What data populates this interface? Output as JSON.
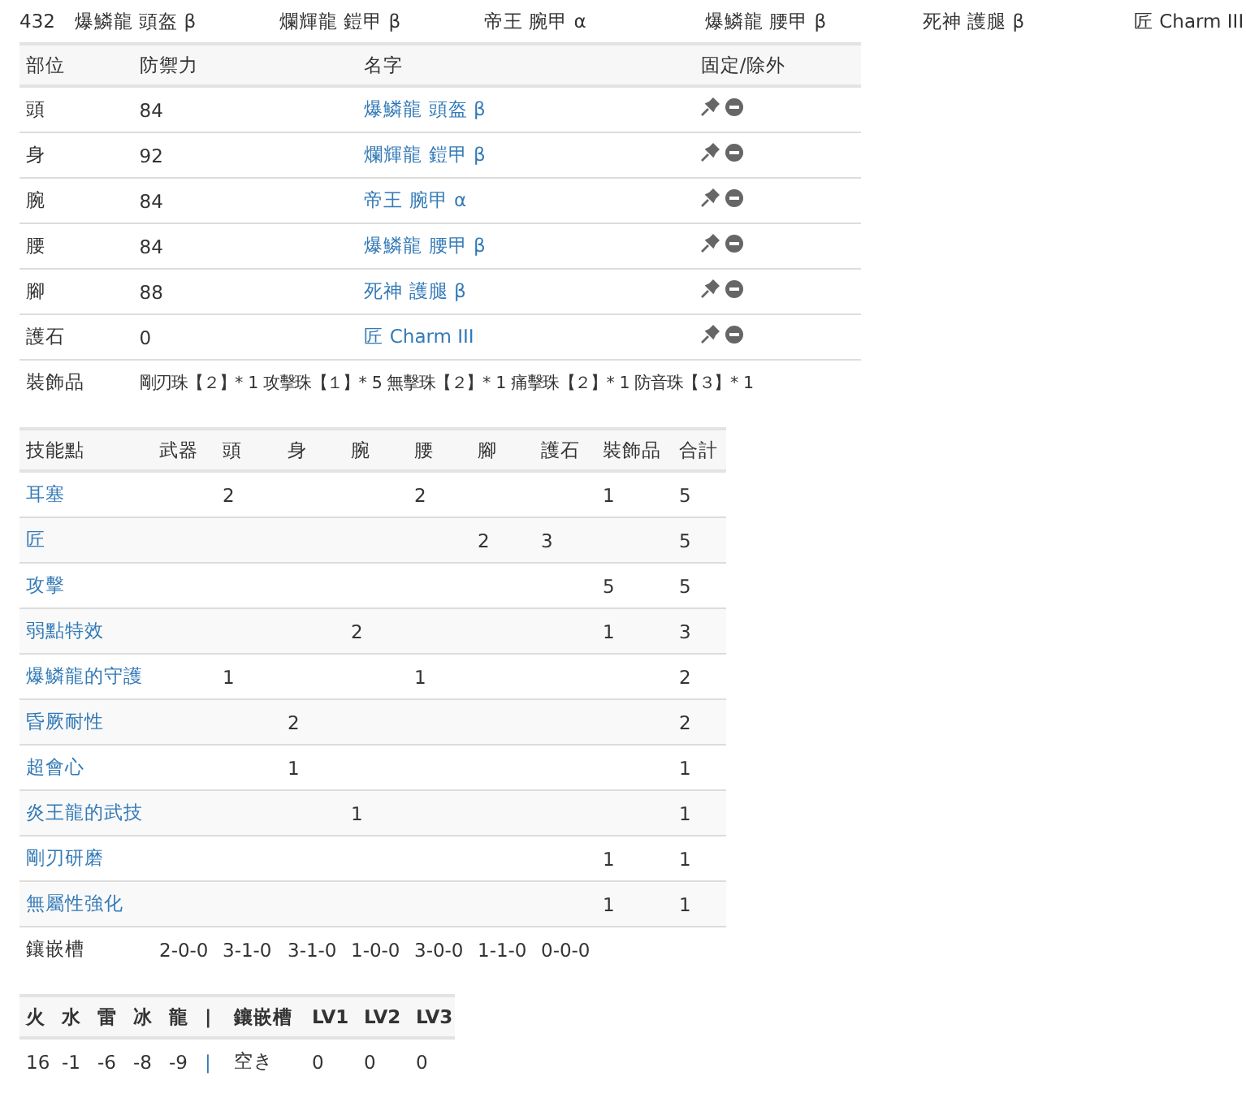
{
  "summary": {
    "defense": "432",
    "pieces": [
      "爆鱗龍 頭盔 β",
      "爛輝龍 鎧甲 β",
      "帝王 腕甲 α",
      "爆鱗龍 腰甲 β",
      "死神 護腿 β",
      "匠 Charm III"
    ]
  },
  "armor_table": {
    "columns": [
      "部位",
      "防禦力",
      "名字",
      "固定/除外"
    ],
    "rows": [
      {
        "part": "頭",
        "defense": "84",
        "name": "爆鱗龍 頭盔 β"
      },
      {
        "part": "身",
        "defense": "92",
        "name": "爛輝龍 鎧甲 β"
      },
      {
        "part": "腕",
        "defense": "84",
        "name": "帝王 腕甲 α"
      },
      {
        "part": "腰",
        "defense": "84",
        "name": "爆鱗龍 腰甲 β"
      },
      {
        "part": "腳",
        "defense": "88",
        "name": "死神 護腿 β"
      },
      {
        "part": "護石",
        "defense": "0",
        "name": "匠 Charm III"
      }
    ],
    "decorations": {
      "label": "裝飾品",
      "text": "剛刃珠【２】* 1 攻擊珠【１】* 5 無擊珠【２】* 1 痛擊珠【２】* 1 防音珠【３】* 1"
    }
  },
  "skill_table": {
    "columns": [
      "技能點",
      "武器",
      "頭",
      "身",
      "腕",
      "腰",
      "腳",
      "護石",
      "裝飾品",
      "合計"
    ],
    "rows": [
      {
        "cells": [
          "耳塞",
          "",
          "2",
          "",
          "",
          "2",
          "",
          "",
          "1",
          "5"
        ]
      },
      {
        "cells": [
          "匠",
          "",
          "",
          "",
          "",
          "",
          "2",
          "3",
          "",
          "5"
        ]
      },
      {
        "cells": [
          "攻擊",
          "",
          "",
          "",
          "",
          "",
          "",
          "",
          "5",
          "5"
        ]
      },
      {
        "cells": [
          "弱點特效",
          "",
          "",
          "",
          "2",
          "",
          "",
          "",
          "1",
          "3"
        ]
      },
      {
        "cells": [
          "爆鱗龍的守護",
          "",
          "1",
          "",
          "",
          "1",
          "",
          "",
          "",
          "2"
        ]
      },
      {
        "cells": [
          "昏厥耐性",
          "",
          "",
          "2",
          "",
          "",
          "",
          "",
          "",
          "2"
        ]
      },
      {
        "cells": [
          "超會心",
          "",
          "",
          "1",
          "",
          "",
          "",
          "",
          "",
          "1"
        ]
      },
      {
        "cells": [
          "炎王龍的武技",
          "",
          "",
          "",
          "1",
          "",
          "",
          "",
          "",
          "1"
        ]
      },
      {
        "cells": [
          "剛刃研磨",
          "",
          "",
          "",
          "",
          "",
          "",
          "",
          "1",
          "1"
        ]
      },
      {
        "cells": [
          "無屬性強化",
          "",
          "",
          "",
          "",
          "",
          "",
          "",
          "1",
          "1"
        ]
      },
      {
        "cells": [
          "鑲嵌槽",
          "2-0-0",
          "3-1-0",
          "3-1-0",
          "1-0-0",
          "3-0-0",
          "1-1-0",
          "0-0-0",
          "",
          ""
        ]
      }
    ]
  },
  "resist_table": {
    "columns": [
      "火",
      "水",
      "雷",
      "冰",
      "龍",
      "|",
      "鑲嵌槽",
      "LV1",
      "LV2",
      "LV3"
    ],
    "values": [
      "16",
      "-1",
      "-6",
      "-8",
      "-9",
      "|",
      "空き",
      "0",
      "0",
      "0"
    ]
  }
}
